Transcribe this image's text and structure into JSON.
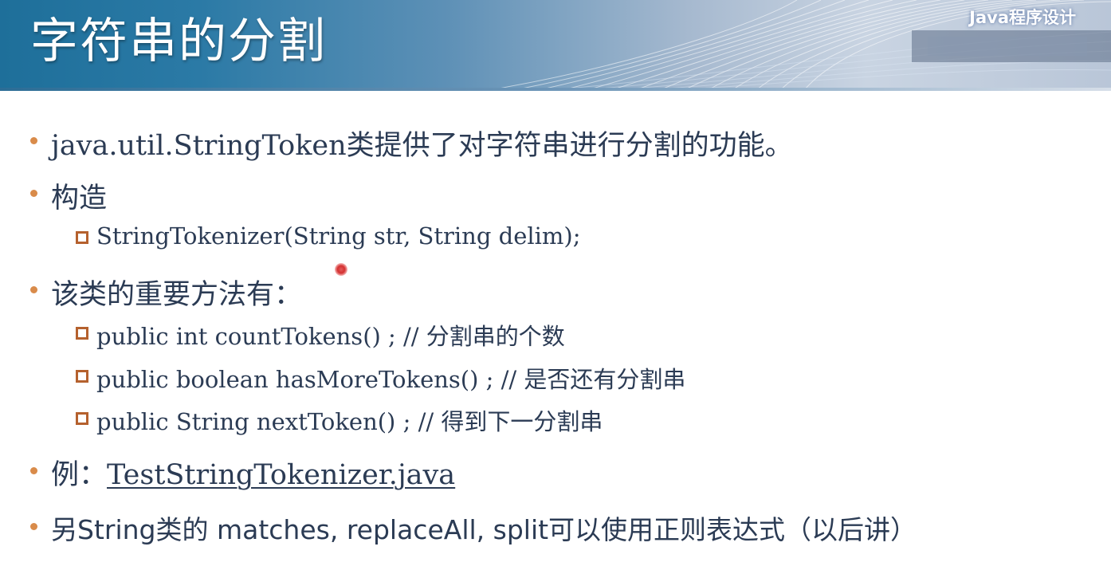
{
  "slide": {
    "title": "字符串的分割",
    "brand": "Java程序设计"
  },
  "bullets": {
    "b1": "java.util.StringToken类提供了对字符串进行分割的功能。",
    "b2": "构造",
    "b2_sub1": "StringTokenizer(String str, String delim);",
    "b3": "该类的重要方法有：",
    "b3_sub1": "public int countTokens() ; // 分割串的个数",
    "b3_sub2": "public boolean hasMoreTokens() ; // 是否还有分割串",
    "b3_sub3": "public String nextToken() ; // 得到下一分割串",
    "b4_prefix": "例：",
    "b4_link": "TestStringTokenizer.java",
    "b5": "另String类的 matches, replaceAll, split可以使用正则表达式（以后讲）"
  },
  "colors": {
    "text": "#2b3b54",
    "bullet": "#d98b4a",
    "square_bullet": "#b5612e",
    "banner": "#2b7aa6"
  }
}
